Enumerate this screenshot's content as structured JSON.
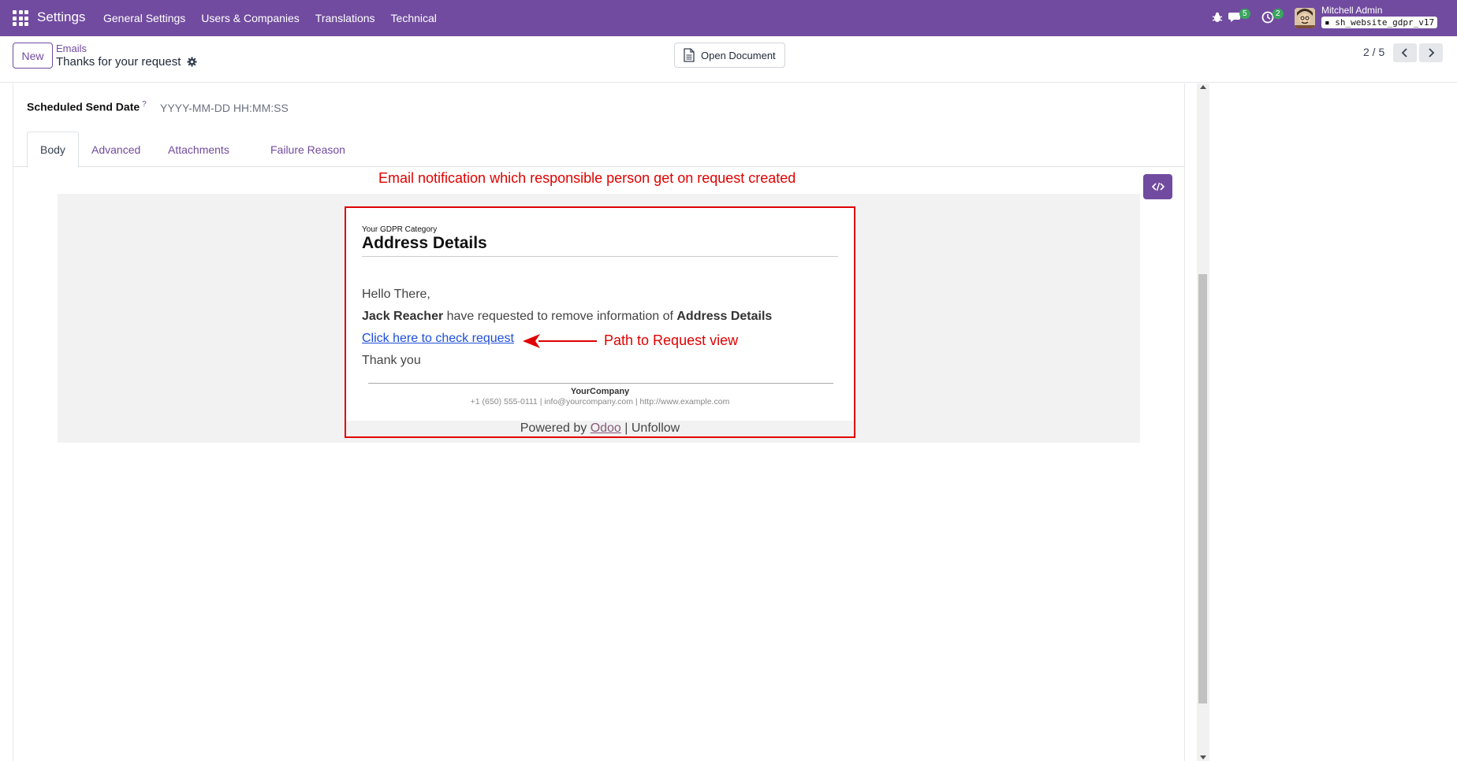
{
  "navbar": {
    "app_title": "Settings",
    "menu": [
      "General Settings",
      "Users & Companies",
      "Translations",
      "Technical"
    ],
    "chat_count": "5",
    "activity_count": "2",
    "user_name": "Mitchell Admin",
    "database": "sh_website_gdpr_v17"
  },
  "control": {
    "new_label": "New",
    "breadcrumb": "Emails",
    "record_title": "Thanks for your request",
    "open_document_label": "Open Document",
    "pager": "2 / 5"
  },
  "form": {
    "scheduled_label": "Scheduled Send Date",
    "scheduled_help": "?",
    "scheduled_placeholder": "YYYY-MM-DD HH:MM:SS",
    "tabs": [
      "Body",
      "Advanced",
      "Attachments",
      "Failure Reason"
    ]
  },
  "annotations": {
    "top": "Email notification which responsible person get on request created",
    "path": "Path to Request view"
  },
  "email": {
    "category": "Your GDPR Category",
    "title": "Address Details",
    "greeting": "Hello There,",
    "requester": "Jack Reacher",
    "request_text": " have requested to remove information of ",
    "request_subject": "Address Details",
    "link_text": "Click here to check request",
    "thanks": "Thank you",
    "company_name": "YourCompany",
    "company_info": "+1 (650) 555-0111 | info@yourcompany.com | http://www.example.com",
    "powered_prefix": "Powered by ",
    "powered_brand": "Odoo",
    "powered_suffix": " | Unfollow"
  },
  "colors": {
    "brand": "#714b9f",
    "annotation": "#e00000",
    "link": "#1d4ed8"
  }
}
